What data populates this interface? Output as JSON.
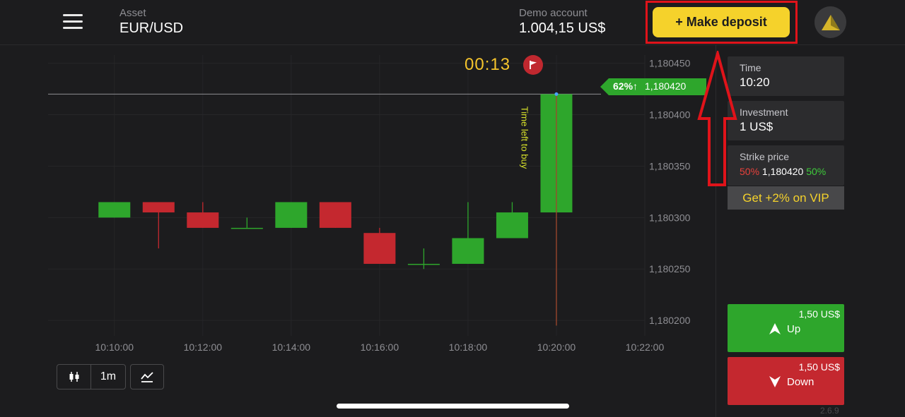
{
  "header": {
    "asset_label": "Asset",
    "asset_value": "EUR/USD",
    "account_label": "Demo account",
    "account_value": "1.004,15 US$",
    "deposit_label": "+ Make deposit"
  },
  "chart": {
    "timer": "00:13",
    "price_tag_percent": "62%↑",
    "price_tag_price": "1,180420",
    "time_left_text": "Time left to buy",
    "price_ticks": [
      "1,180450",
      "1,180400",
      "1,180350",
      "1,180300",
      "1,180250",
      "1,180200"
    ],
    "time_ticks": [
      "10:10:00",
      "10:12:00",
      "10:14:00",
      "10:16:00",
      "10:18:00",
      "10:20:00",
      "10:22:00"
    ],
    "colors": {
      "up": "#2ea62c",
      "down": "#c4282f",
      "grid": "#262628",
      "axis_text": "#8e8e93"
    }
  },
  "chart_data": {
    "type": "candlestick",
    "x_unit": "minutes after 10:10:00",
    "xlim": [
      -1.5,
      12.0
    ],
    "ylim": [
      1.180185,
      1.180458
    ],
    "candles": [
      {
        "t": 0,
        "open": 1.180315,
        "close": 1.1803,
        "high": 1.180315,
        "low": 1.1803,
        "dir": "up"
      },
      {
        "t": 1,
        "open": 1.180315,
        "close": 1.180305,
        "high": 1.180315,
        "low": 1.18027,
        "dir": "down"
      },
      {
        "t": 2,
        "open": 1.180305,
        "close": 1.18029,
        "high": 1.180315,
        "low": 1.18029,
        "dir": "down"
      },
      {
        "t": 3,
        "open": 1.18029,
        "close": 1.18029,
        "high": 1.1803,
        "low": 1.18029,
        "dir": "up"
      },
      {
        "t": 4,
        "open": 1.18029,
        "close": 1.180315,
        "high": 1.180315,
        "low": 1.18029,
        "dir": "up"
      },
      {
        "t": 5,
        "open": 1.180315,
        "close": 1.18029,
        "high": 1.180315,
        "low": 1.18029,
        "dir": "down"
      },
      {
        "t": 6,
        "open": 1.180285,
        "close": 1.180255,
        "high": 1.18029,
        "low": 1.180255,
        "dir": "down"
      },
      {
        "t": 7,
        "open": 1.180255,
        "close": 1.180255,
        "high": 1.18027,
        "low": 1.18025,
        "dir": "up"
      },
      {
        "t": 8,
        "open": 1.180255,
        "close": 1.18028,
        "high": 1.180315,
        "low": 1.180255,
        "dir": "up"
      },
      {
        "t": 9,
        "open": 1.18028,
        "close": 1.180305,
        "high": 1.180315,
        "low": 1.18028,
        "dir": "up"
      },
      {
        "t": 10,
        "open": 1.180305,
        "close": 1.18042,
        "high": 1.18042,
        "low": 1.180195,
        "dir": "up"
      }
    ],
    "current_price": 1.18042
  },
  "toolbar": {
    "interval_label": "1m"
  },
  "side": {
    "time_label": "Time",
    "time_value": "10:20",
    "investment_label": "Investment",
    "investment_value": "1 US$",
    "strike_label": "Strike price",
    "strike_left_pct": "50%",
    "strike_price": "1,180420",
    "strike_right_pct": "50%",
    "vip_label": "Get +2% on VIP",
    "up_payout": "1,50 US$",
    "up_label": "Up",
    "down_payout": "1,50 US$",
    "down_label": "Down",
    "version": "2.6.9"
  }
}
